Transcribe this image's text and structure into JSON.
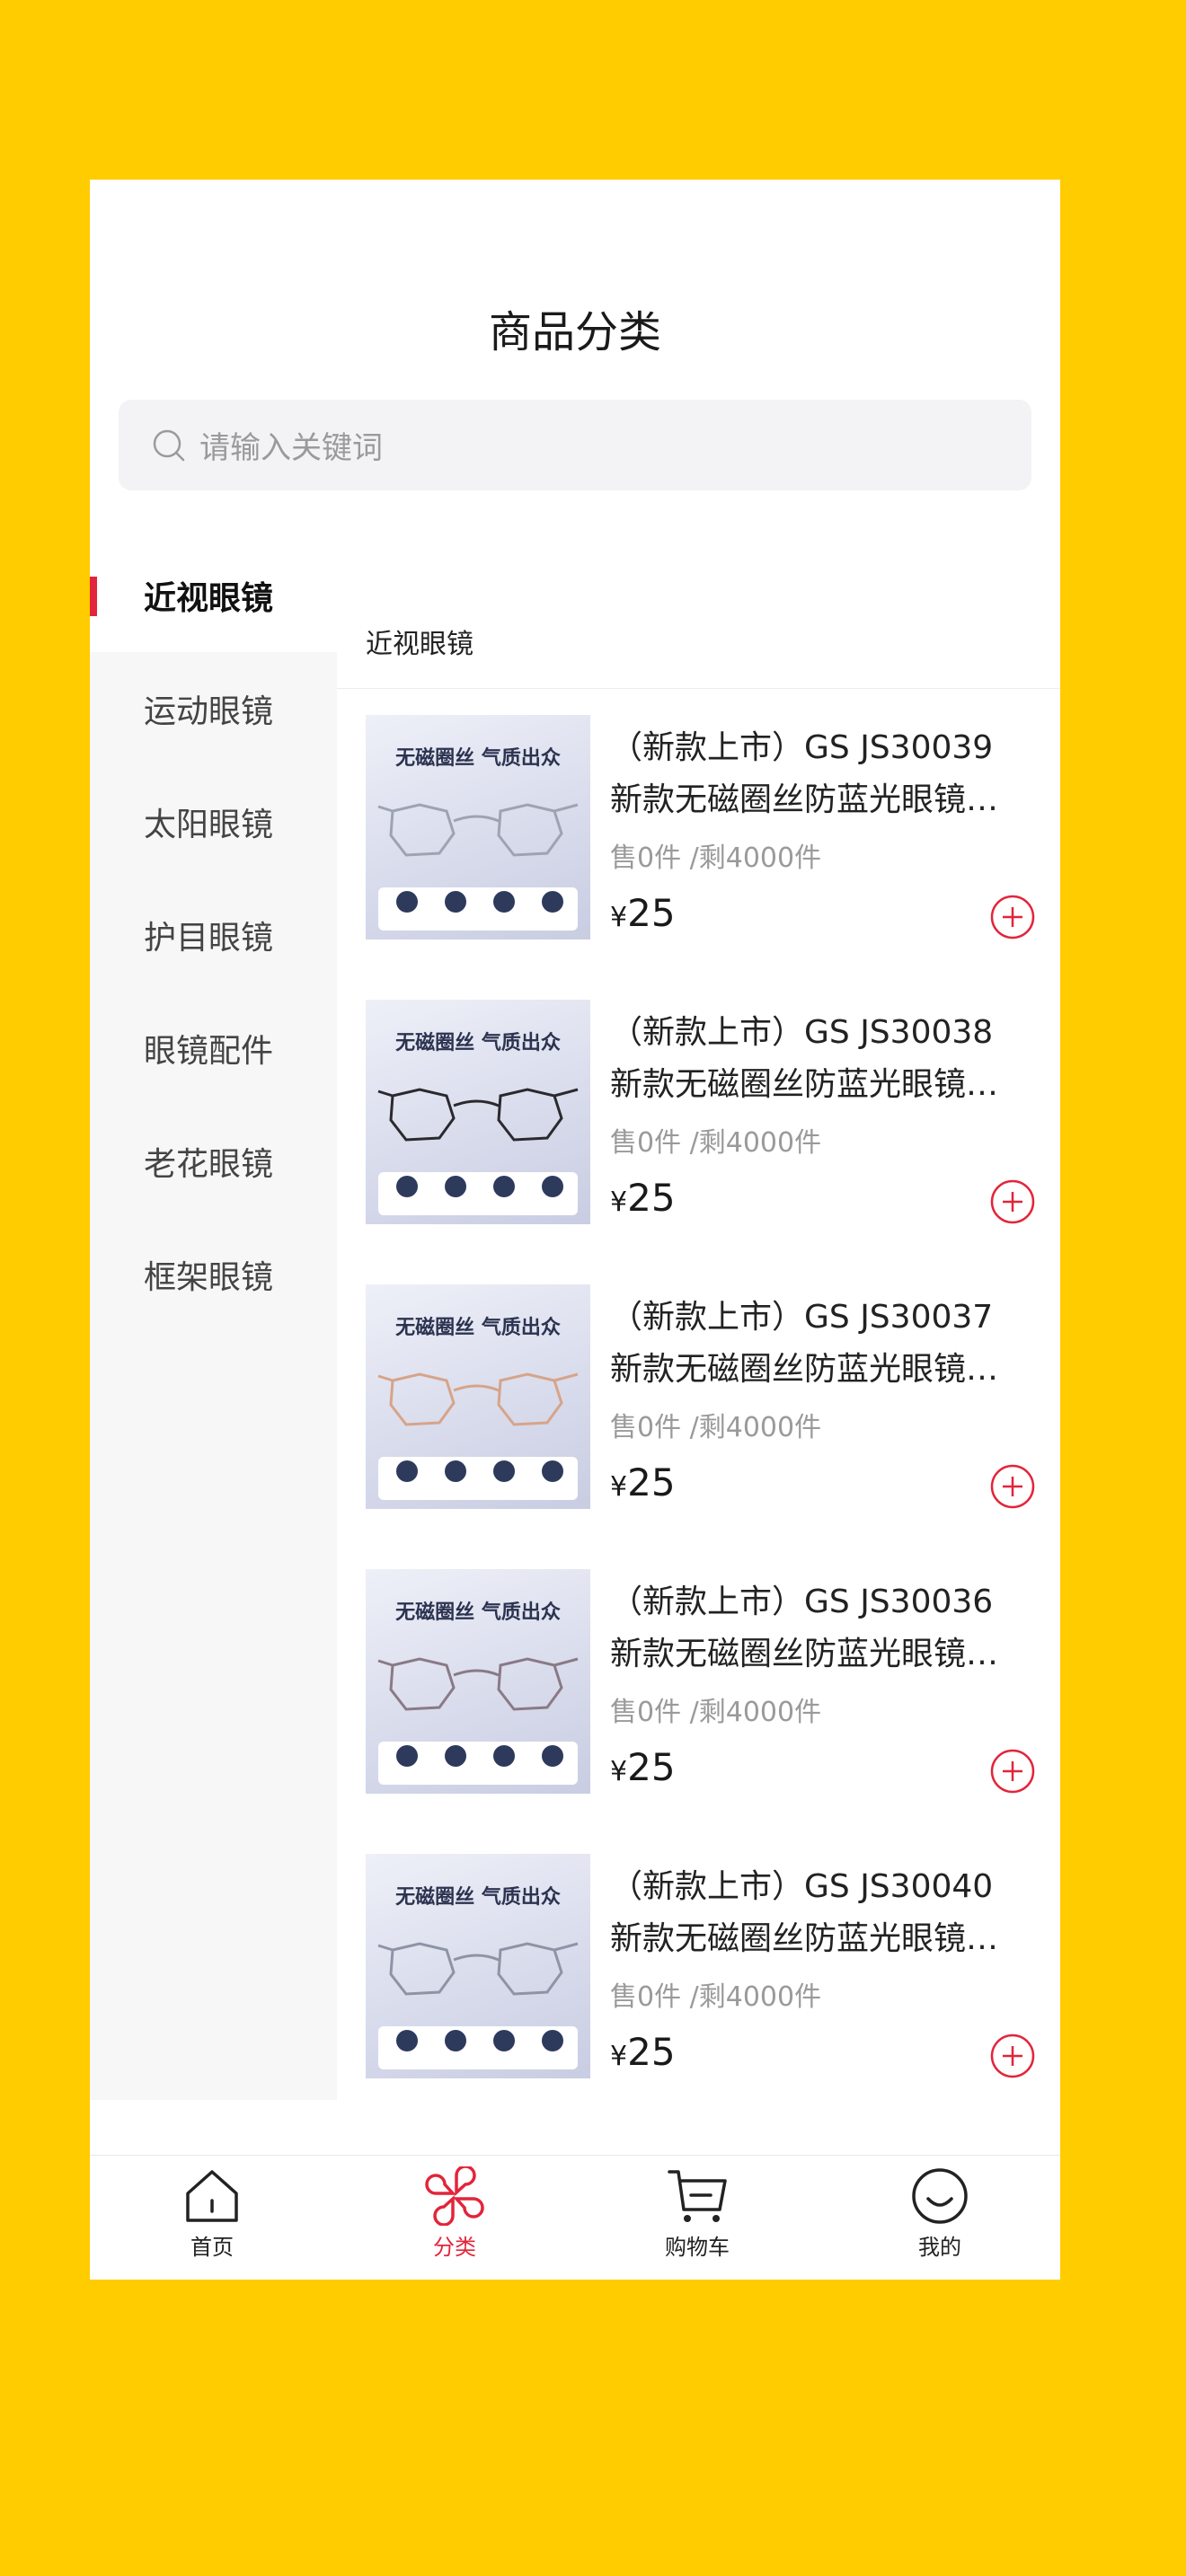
{
  "page": {
    "title": "商品分类",
    "search_placeholder": "请输入关键词"
  },
  "sidebar": {
    "items": [
      {
        "label": "近视眼镜",
        "active": true
      },
      {
        "label": "运动眼镜"
      },
      {
        "label": "太阳眼镜"
      },
      {
        "label": "护目眼镜"
      },
      {
        "label": "眼镜配件"
      },
      {
        "label": "老花眼镜"
      },
      {
        "label": "框架眼镜"
      }
    ]
  },
  "content": {
    "category_title": "近视眼镜",
    "products": [
      {
        "name_line1": "（新款上市）GS JS30039",
        "name_line2": "新款无磁圈丝防蓝光眼镜…",
        "sold": "售0件 /剩4000件",
        "currency": "¥",
        "price": "25",
        "frame_color": "#9ea3b2",
        "img_title": "无磁圈丝 气质出众"
      },
      {
        "name_line1": "（新款上市）GS JS30038",
        "name_line2": "新款无磁圈丝防蓝光眼镜…",
        "sold": "售0件 /剩4000件",
        "currency": "¥",
        "price": "25",
        "frame_color": "#2a2a2e",
        "img_title": "无磁圈丝 气质出众"
      },
      {
        "name_line1": "（新款上市）GS JS30037",
        "name_line2": "新款无磁圈丝防蓝光眼镜…",
        "sold": "售0件 /剩4000件",
        "currency": "¥",
        "price": "25",
        "frame_color": "#d6a48a",
        "img_title": "无磁圈丝 气质出众"
      },
      {
        "name_line1": "（新款上市）GS JS30036",
        "name_line2": "新款无磁圈丝防蓝光眼镜…",
        "sold": "售0件 /剩4000件",
        "currency": "¥",
        "price": "25",
        "frame_color": "#8a7a86",
        "img_title": "无磁圈丝 气质出众"
      },
      {
        "name_line1": "（新款上市）GS JS30040",
        "name_line2": "新款无磁圈丝防蓝光眼镜…",
        "sold": "售0件 /剩4000件",
        "currency": "¥",
        "price": "25",
        "frame_color": "#8e94a6",
        "img_title": "无磁圈丝 气质出众"
      }
    ]
  },
  "tabbar": {
    "items": [
      {
        "label": "首页",
        "icon": "home-icon"
      },
      {
        "label": "分类",
        "icon": "category-icon",
        "active": true
      },
      {
        "label": "购物车",
        "icon": "cart-icon"
      },
      {
        "label": "我的",
        "icon": "profile-icon"
      }
    ]
  },
  "colors": {
    "accent": "#e3243a",
    "background": "#FFCC00"
  }
}
